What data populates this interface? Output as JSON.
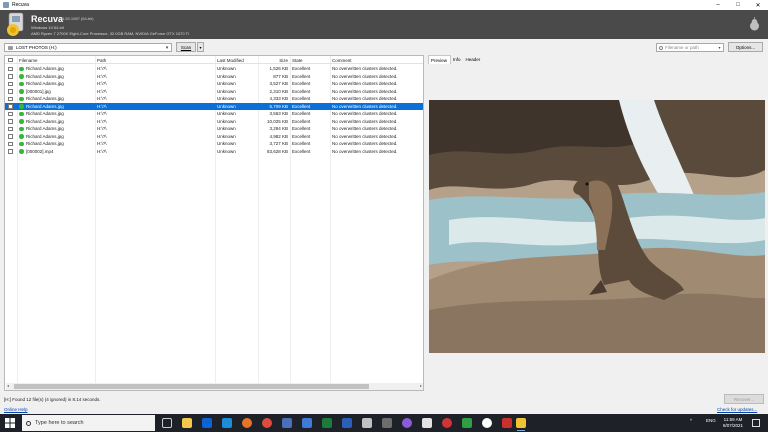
{
  "window": {
    "title": "Recuva"
  },
  "header": {
    "app_name": "Recuva",
    "version": "v1.53.1087 (64-bit)",
    "os": "Windows 10 64-bit",
    "hardware": "AMD Ryzen 7 2700X Eight-Core Processor, 32.0GB RAM, NVIDIA GeForce GTX 1070 Ti"
  },
  "toolbar": {
    "drive": "LOST PHOTOS (H:)",
    "scan_label": "Scan",
    "filter_placeholder": "Filename or path",
    "options_label": "Options..."
  },
  "file_list": {
    "columns": [
      "Filename",
      "Path",
      "Last Modified",
      "Size",
      "State",
      "Comment"
    ],
    "rows": [
      {
        "filename": "Richard Adams.jpg",
        "path": "H:\\?\\",
        "modified": "Unknown",
        "size": "1,526 KB",
        "state": "Excellent",
        "comment": "No overwritten clusters detected."
      },
      {
        "filename": "Richard Adams.jpg",
        "path": "H:\\?\\",
        "modified": "Unknown",
        "size": "877 KB",
        "state": "Excellent",
        "comment": "No overwritten clusters detected."
      },
      {
        "filename": "Richard Adams.jpg",
        "path": "H:\\?\\",
        "modified": "Unknown",
        "size": "3,527 KB",
        "state": "Excellent",
        "comment": "No overwritten clusters detected."
      },
      {
        "filename": "[000001].jpg",
        "path": "H:\\?\\",
        "modified": "Unknown",
        "size": "2,310 KB",
        "state": "Excellent",
        "comment": "No overwritten clusters detected."
      },
      {
        "filename": "Richard Adams.jpg",
        "path": "H:\\?\\",
        "modified": "Unknown",
        "size": "4,333 KB",
        "state": "Excellent",
        "comment": "No overwritten clusters detected."
      },
      {
        "filename": "Richard Adams.jpg",
        "path": "H:\\?\\",
        "modified": "Unknown",
        "size": "5,709 KB",
        "state": "Excellent",
        "comment": "No overwritten clusters detected."
      },
      {
        "filename": "Richard Adams.jpg",
        "path": "H:\\?\\",
        "modified": "Unknown",
        "size": "3,563 KB",
        "state": "Excellent",
        "comment": "No overwritten clusters detected."
      },
      {
        "filename": "Richard Adams.jpg",
        "path": "H:\\?\\",
        "modified": "Unknown",
        "size": "10,025 KB",
        "state": "Excellent",
        "comment": "No overwritten clusters detected."
      },
      {
        "filename": "Richard Adams.jpg",
        "path": "H:\\?\\",
        "modified": "Unknown",
        "size": "3,294 KB",
        "state": "Excellent",
        "comment": "No overwritten clusters detected."
      },
      {
        "filename": "Richard Adams.jpg",
        "path": "H:\\?\\",
        "modified": "Unknown",
        "size": "4,982 KB",
        "state": "Excellent",
        "comment": "No overwritten clusters detected."
      },
      {
        "filename": "Richard Adams.jpg",
        "path": "H:\\?\\",
        "modified": "Unknown",
        "size": "3,727 KB",
        "state": "Excellent",
        "comment": "No overwritten clusters detected."
      },
      {
        "filename": "[000002].mp4",
        "path": "H:\\?\\",
        "modified": "Unknown",
        "size": "83,628 KB",
        "state": "Excellent",
        "comment": "No overwritten clusters detected."
      }
    ],
    "selected_row": 5
  },
  "preview_panel": {
    "tabs": [
      "Preview",
      "Info",
      "Header"
    ]
  },
  "status": {
    "text": "[H:] Found 12 file(s) (4 ignored) in 8.14 seconds.",
    "recover_label": "Recover..."
  },
  "links": {
    "help": "Online Help",
    "updates": "Check for updates..."
  },
  "taskbar": {
    "search_placeholder": "Type here to search",
    "language": "ENG",
    "time": "11:59 AM",
    "date": "8/07/2021"
  }
}
